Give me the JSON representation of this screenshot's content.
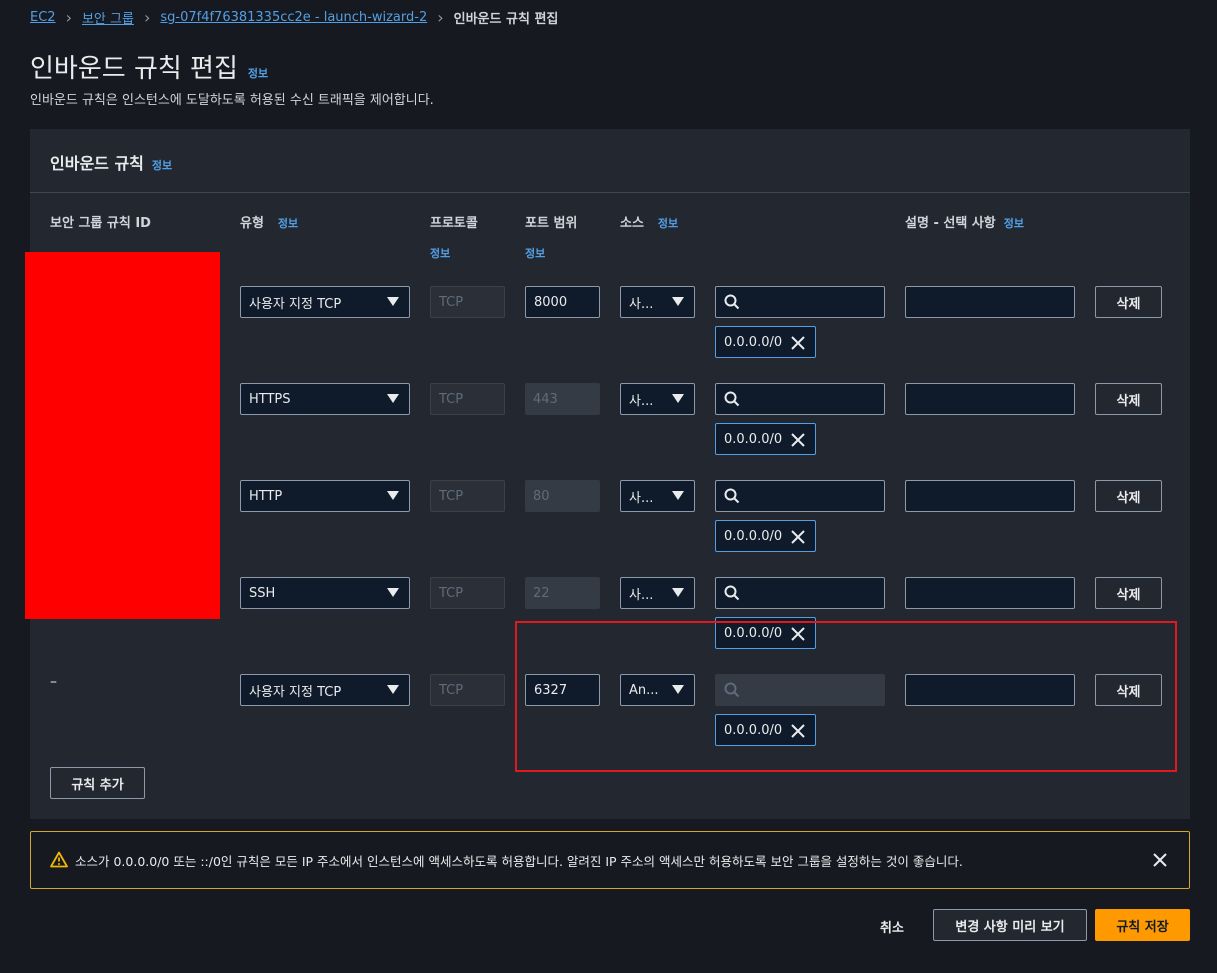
{
  "breadcrumb": {
    "item1": "EC2",
    "item2": "보안 그룹",
    "item3": "sg-07f4f76381335cc2e - launch-wizard-2",
    "current": "인바운드 규칙 편집"
  },
  "page": {
    "title": "인바운드 규칙 편집",
    "info": "정보",
    "description": "인바운드 규칙은 인스턴스에 도달하도록 허용된 수신 트래픽을 제어합니다."
  },
  "panel": {
    "title": "인바운드 규칙",
    "info": "정보"
  },
  "columns": {
    "rule_id": "보안 그룹 규칙 ID",
    "type": "유형",
    "type_info": "정보",
    "protocol": "프로토콜",
    "protocol_info": "정보",
    "port_range": "포트 범위",
    "port_info": "정보",
    "source": "소스",
    "source_info": "정보",
    "description": "설명 - 선택 사항",
    "description_info": "정보"
  },
  "rows": [
    {
      "rule_id": "",
      "type": "사용자 지정 TCP",
      "protocol": "TCP",
      "port": "8000",
      "source": "사...",
      "token": "0.0.0.0/0",
      "delete": "삭제"
    },
    {
      "rule_id": "",
      "type": "HTTPS",
      "protocol": "TCP",
      "port": "443",
      "source": "사...",
      "token": "0.0.0.0/0",
      "delete": "삭제"
    },
    {
      "rule_id": "",
      "type": "HTTP",
      "protocol": "TCP",
      "port": "80",
      "source": "사...",
      "token": "0.0.0.0/0",
      "delete": "삭제"
    },
    {
      "rule_id": "",
      "type": "SSH",
      "protocol": "TCP",
      "port": "22",
      "source": "사...",
      "token": "0.0.0.0/0",
      "delete": "삭제"
    },
    {
      "rule_id": "–",
      "type": "사용자 지정 TCP",
      "protocol": "TCP",
      "port": "6327",
      "source": "An...",
      "token": "0.0.0.0/0",
      "delete": "삭제"
    }
  ],
  "add_rule": "규칙 추가",
  "warning": {
    "text": "소스가 0.0.0.0/0 또는 ::/0인 규칙은 모든 IP 주소에서 인스턴스에 액세스하도록 허용합니다. 알려진 IP 주소의 액세스만 허용하도록 보안 그룹을 설정하는 것이 좋습니다."
  },
  "footer": {
    "cancel": "취소",
    "preview": "변경 사항 미리 보기",
    "save": "규칙 저장"
  },
  "colors": {
    "background": "#16191f",
    "panel": "#232730",
    "link": "#539fe5",
    "primary": "#ff9900",
    "warning_border": "#d4a72c",
    "highlight": "#e0191e"
  }
}
